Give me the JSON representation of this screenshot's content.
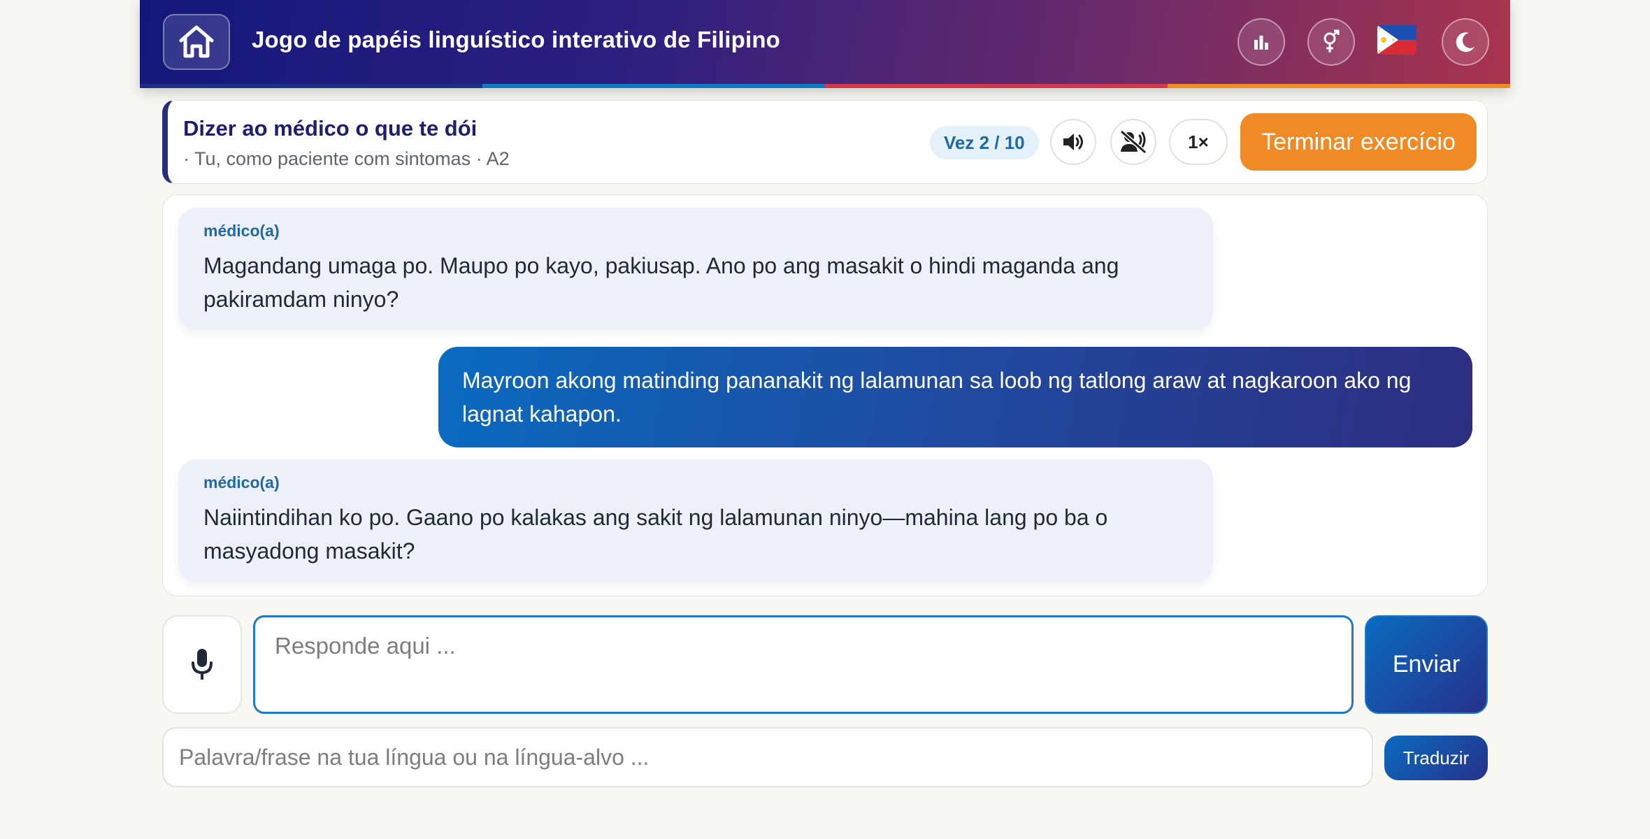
{
  "header": {
    "title": "Jogo de papéis linguístico interativo de Filipino",
    "icons": [
      "home-icon",
      "stats-icon",
      "gender-icon",
      "philippines-flag-icon",
      "moon-icon"
    ],
    "stripe_colors": [
      "#1c2f86",
      "#0e7ac4",
      "#d23a4b",
      "#f08a24"
    ]
  },
  "scenario": {
    "title": "Dizer ao médico o que te dói",
    "subtitle": "· Tu, como paciente com sintomas · A2",
    "turn": "Vez 2 / 10",
    "speed": "1×",
    "finish_label": "Terminar exercício"
  },
  "messages": [
    {
      "role": "bot",
      "speaker": "médico(a)",
      "text": "Magandang umaga po. Maupo po kayo, pakiusap. Ano po ang masakit o hindi maganda ang pakiramdam ninyo?"
    },
    {
      "role": "user",
      "text": "Mayroon akong matinding pananakit ng lalamunan sa loob ng tatlong araw at nagkaroon ako ng lagnat kahapon."
    },
    {
      "role": "bot",
      "speaker": "médico(a)",
      "text": "Naiintindihan ko po. Gaano po kalakas ang sakit ng lalamunan ninyo—mahina lang po ba o masyadong masakit?"
    }
  ],
  "input": {
    "placeholder": "Responde aqui ...",
    "value": "",
    "send_label": "Enviar"
  },
  "translate": {
    "placeholder": "Palavra/frase na tua língua ou na língua-alvo ...",
    "value": "",
    "button_label": "Traduzir"
  },
  "colors": {
    "accent": "#1f78c8",
    "finish": "#f08a24",
    "speaker": "#1f6aa6"
  }
}
